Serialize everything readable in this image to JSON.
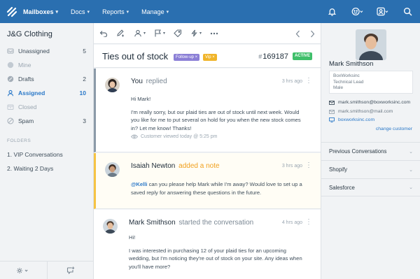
{
  "nav": {
    "items": [
      {
        "label": "Mailboxes",
        "active": true
      },
      {
        "label": "Docs",
        "active": false
      },
      {
        "label": "Reports",
        "active": false
      },
      {
        "label": "Manage",
        "active": false
      }
    ],
    "icons": [
      "logo-icon",
      "bell-icon",
      "smiley-icon",
      "user-menu-icon",
      "search-icon"
    ],
    "colors": {
      "bar": "#2a6fb0",
      "text": "#ffffff"
    }
  },
  "sidebar": {
    "mailbox_name": "J&G Clothing",
    "folders": [
      {
        "label": "Unassigned",
        "count": "5",
        "icon": "unassigned-icon"
      },
      {
        "label": "Mine",
        "count": "",
        "icon": "mine-icon"
      },
      {
        "label": "Drafts",
        "count": "2",
        "icon": "drafts-icon"
      },
      {
        "label": "Assigned",
        "count": "10",
        "icon": "assigned-icon"
      },
      {
        "label": "Closed",
        "count": "",
        "icon": "closed-icon"
      },
      {
        "label": "Spam",
        "count": "3",
        "icon": "spam-icon"
      }
    ],
    "saved_heading": "FOLDERS",
    "saved_folders": [
      "1. VIP Conversations",
      "2. Waiting 2 Days"
    ],
    "accent": "#2a78c8"
  },
  "conversation": {
    "subject": "Ties out of stock",
    "tags": [
      "Follow-up",
      "Vip"
    ],
    "ticket_hash": "#",
    "ticket_number": "169187",
    "status": "ACTIVE",
    "status_color": "#3fbf6a",
    "toolbar_icons": [
      "reply-icon",
      "note-icon",
      "assign-icon",
      "status-flag-icon",
      "tag-icon",
      "workflow-icon",
      "more-icon",
      "previous-icon",
      "next-icon"
    ],
    "messages": [
      {
        "author": "You",
        "verb": "replied",
        "time": "3 hrs ago",
        "type": "reply",
        "paragraphs": [
          "Hi Mark!",
          "I'm really sorry, but our plaid ties are out of stock until next week. Would you like for me to put several on hold for you when the new stock comes in? Let me know! Thanks!"
        ],
        "viewed": "Customer viewed today @ 5:25 pm"
      },
      {
        "author": "Isaiah Newton",
        "verb": "added a note",
        "time": "3 hrs ago",
        "type": "note",
        "mention": "@Kelli",
        "text": " can you please help Mark while I'm away? Would love to set up a saved reply for answering these questions in the future."
      },
      {
        "author": "Mark Smithson",
        "verb": "started the conversation",
        "time": "4 hrs ago",
        "type": "customer",
        "paragraphs": [
          "Hi!",
          "I was interested in purchasing 12 of your plaid ties for an upcoming wedding, but I'm noticing they're out of stock on your site. Any ideas when you'll have more?"
        ]
      }
    ]
  },
  "customer": {
    "name": "Mark Smithson",
    "company": "BoxWorksinc",
    "title": "Technical Lead",
    "gender": "Male",
    "emails": [
      "mark.smithson@boxworksinc.com",
      "mark.smithson@mail.com"
    ],
    "website": "boxworksinc.com",
    "change_link": "change customer",
    "sections": [
      "Previous Conversations",
      "Shopify",
      "Salesforce"
    ]
  }
}
